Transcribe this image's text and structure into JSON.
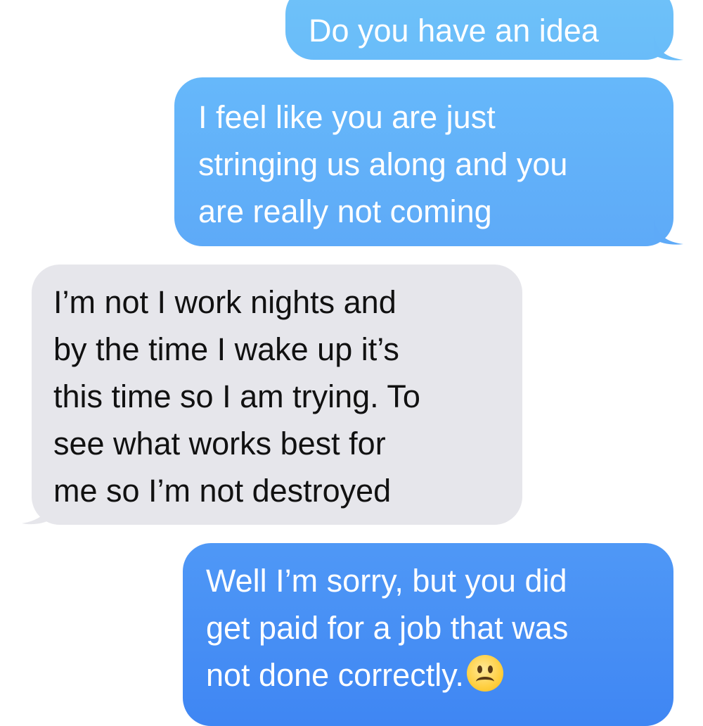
{
  "conversation": {
    "messages": [
      {
        "sender": "me",
        "lines": [
          "Do you have an idea"
        ]
      },
      {
        "sender": "me",
        "lines": [
          "I feel like you are  just",
          "stringing us along and you",
          "are really not coming"
        ]
      },
      {
        "sender": "them",
        "lines": [
          "I’m not I work nights and",
          "by the time I wake up it’s",
          "this time so I am trying. To",
          "see what works best for",
          "me so I’m not destroyed"
        ]
      },
      {
        "sender": "me",
        "lines": [
          "Well I’m sorry, but you did",
          "get paid for a job that was",
          "not done correctly."
        ],
        "trailing_icon": "frowning-face-emoji"
      }
    ]
  },
  "colors": {
    "sent_bubble_top": "#6fc2f9",
    "sent_bubble_bottom": "#3f86f3",
    "received_bubble": "#e6e6eb",
    "sent_text": "#ffffff",
    "received_text": "#111111"
  }
}
